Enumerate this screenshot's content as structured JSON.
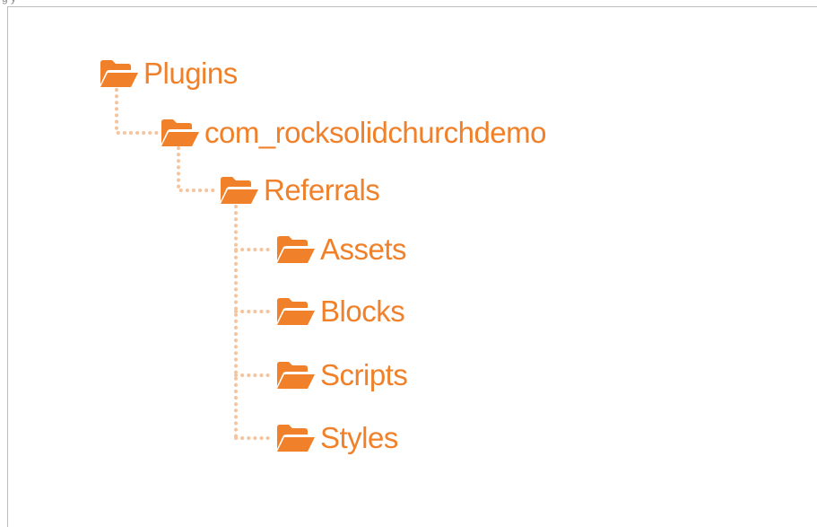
{
  "accent_color": "#f0812a",
  "connector_color": "#f5c49d",
  "top_fragment": "g     y",
  "tree": {
    "nodes": [
      {
        "id": "plugins",
        "label": "Plugins",
        "icon": "folder-open-icon",
        "level": 0
      },
      {
        "id": "com-rocksolidchurchdemo",
        "label": "com_rocksolidchurchdemo",
        "icon": "folder-open-icon",
        "level": 1
      },
      {
        "id": "referrals",
        "label": "Referrals",
        "icon": "folder-open-icon",
        "level": 2
      },
      {
        "id": "assets",
        "label": "Assets",
        "icon": "folder-open-icon",
        "level": 3
      },
      {
        "id": "blocks",
        "label": "Blocks",
        "icon": "folder-open-icon",
        "level": 3
      },
      {
        "id": "scripts",
        "label": "Scripts",
        "icon": "folder-open-icon",
        "level": 3
      },
      {
        "id": "styles",
        "label": "Styles",
        "icon": "folder-open-icon",
        "level": 3
      }
    ]
  }
}
